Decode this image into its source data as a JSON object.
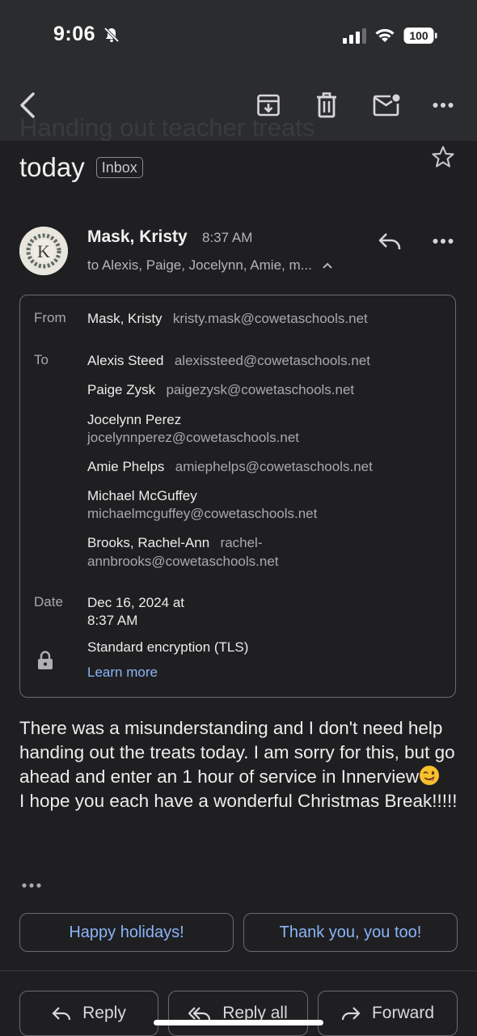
{
  "status_bar": {
    "time": "9:06",
    "battery": "100"
  },
  "email": {
    "subject_partial": "Handing out teacher treats",
    "subject_end": "today",
    "label": "Inbox",
    "sender_name": "Mask, Kristy",
    "sent_time": "8:37 AM",
    "recipients_summary": "to Alexis, Paige, Jocelynn, Amie, m..."
  },
  "details": {
    "from_label": "From",
    "from_name": "Mask, Kristy",
    "from_email": "kristy.mask@cowetaschools.net",
    "to_label": "To",
    "recipients": [
      {
        "name": "Alexis Steed",
        "email": "alexissteed@cowetaschools.net"
      },
      {
        "name": "Paige Zysk",
        "email": "paigezysk@cowetaschools.net"
      },
      {
        "name": "Jocelynn Perez",
        "email": "jocelynnperez@cowetaschools.net"
      },
      {
        "name": "Amie Phelps",
        "email": "amiephelps@cowetaschools.net"
      },
      {
        "name": "Michael McGuffey",
        "email": "michaelmcguffey@cowetaschools.net"
      },
      {
        "name": "Brooks, Rachel-Ann",
        "email_line1": "rachel-",
        "email_line2": "annbrooks@cowetaschools.net"
      }
    ],
    "date_label": "Date",
    "date_line1": "Dec 16, 2024 at",
    "date_line2": "8:37 AM",
    "encryption": "Standard encryption (TLS)",
    "learn_more": "Learn more"
  },
  "body": {
    "paragraph1": "There was a misunderstanding and I don't need help handing out the treats today. I am sorry for this, but go ahead and enter an 1 hour of service in Innerview",
    "paragraph2": "I hope you each have a wonderful Christmas Break!!!!!"
  },
  "smart_replies": [
    "Happy holidays!",
    "Thank you, you too!"
  ],
  "actions": {
    "reply": "Reply",
    "reply_all": "Reply all",
    "forward": "Forward"
  },
  "colors": {
    "background": "#1f1f21",
    "link": "#8ab4f8",
    "bar": "#2b2c2e"
  }
}
